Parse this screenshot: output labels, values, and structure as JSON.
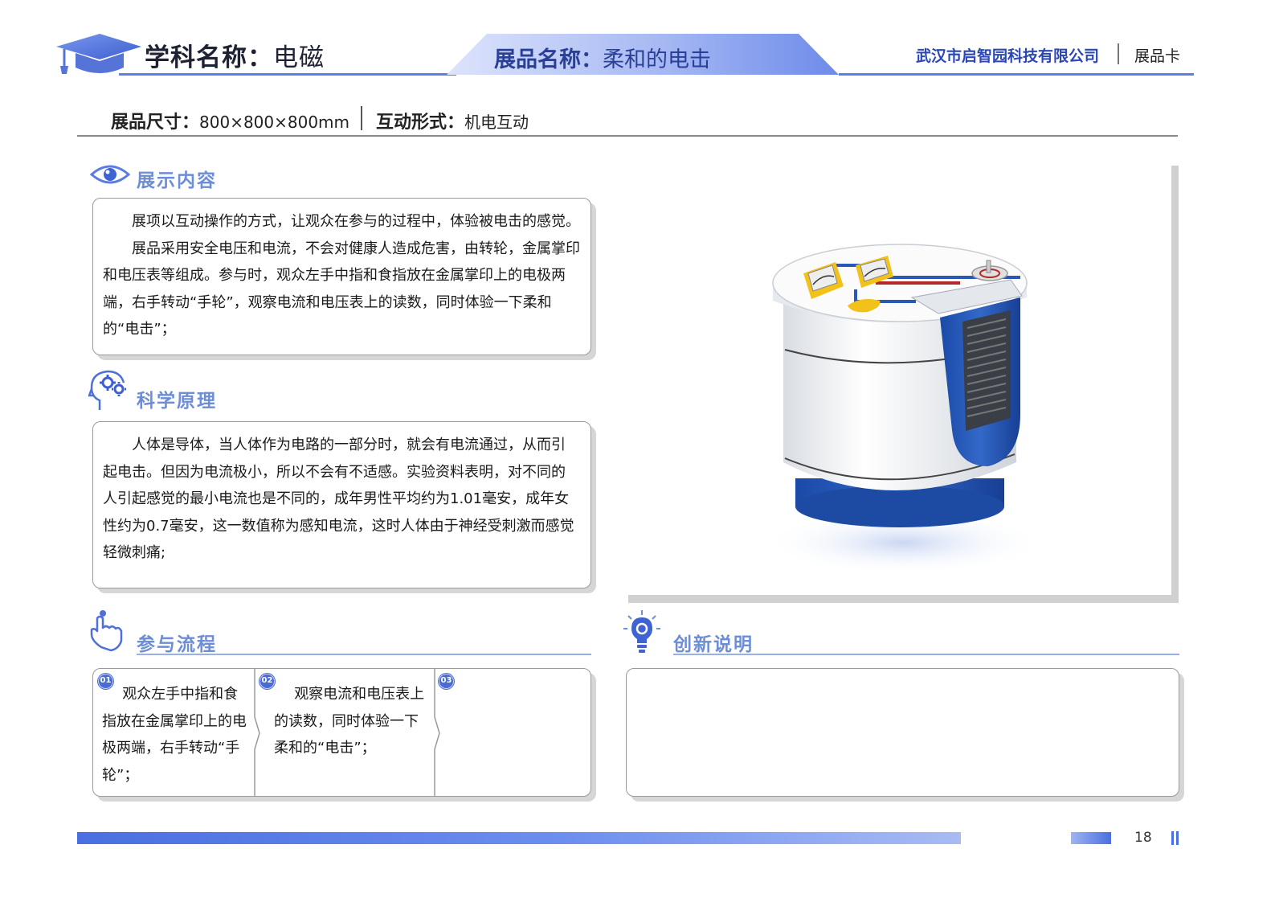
{
  "header": {
    "subject_label": "学科名称：",
    "subject_value": "电磁",
    "exhibit_label": "展品名称：",
    "exhibit_value": "柔和的电击",
    "company": "武汉市启智园科技有限公司",
    "card_type": "展品卡"
  },
  "specs": {
    "size_label": "展品尺寸：",
    "size_value": "800×800×800mm",
    "mode_label": "互动形式：",
    "mode_value": "机电互动"
  },
  "display": {
    "title": "展示内容",
    "p1": "展项以互动操作的方式，让观众在参与的过程中，体验被电击的感觉。",
    "p2": "展品采用安全电压和电流，不会对健康人造成危害，由转轮，金属掌印和电压表等组成。参与时，观众左手中指和食指放在金属掌印上的电极两端，右手转动“手轮”，观察电流和电压表上的读数，同时体验一下柔和的“电击”；"
  },
  "principle": {
    "title": "科学原理",
    "p1": "人体是导体，当人体作为电路的一部分时，就会有电流通过，从而引起电击。但因为电流极小，所以不会有不适感。实验资料表明，对不同的人引起感觉的最小电流也是不同的，成年男性平均约为1.01毫安，成年女性约为0.7毫安，这一数值称为感知电流，这时人体由于神经受刺激而感觉轻微刺痛;"
  },
  "process": {
    "title": "参与流程",
    "steps": [
      {
        "badge": "01",
        "text": "观众左手中指和食指放在金属掌印上的电极两端，右手转动“手轮”；"
      },
      {
        "badge": "02",
        "text": "观察电流和电压表上的读数，同时体验一下柔和的“电击”；"
      },
      {
        "badge": "03",
        "text": ""
      }
    ]
  },
  "innovation": {
    "title": "创新说明",
    "text": ""
  },
  "footer": {
    "page_number": "18"
  },
  "colors": {
    "accent": "#4a6fe0",
    "heading": "#6d8ed6",
    "exhibit_blue": "#2457b3"
  }
}
